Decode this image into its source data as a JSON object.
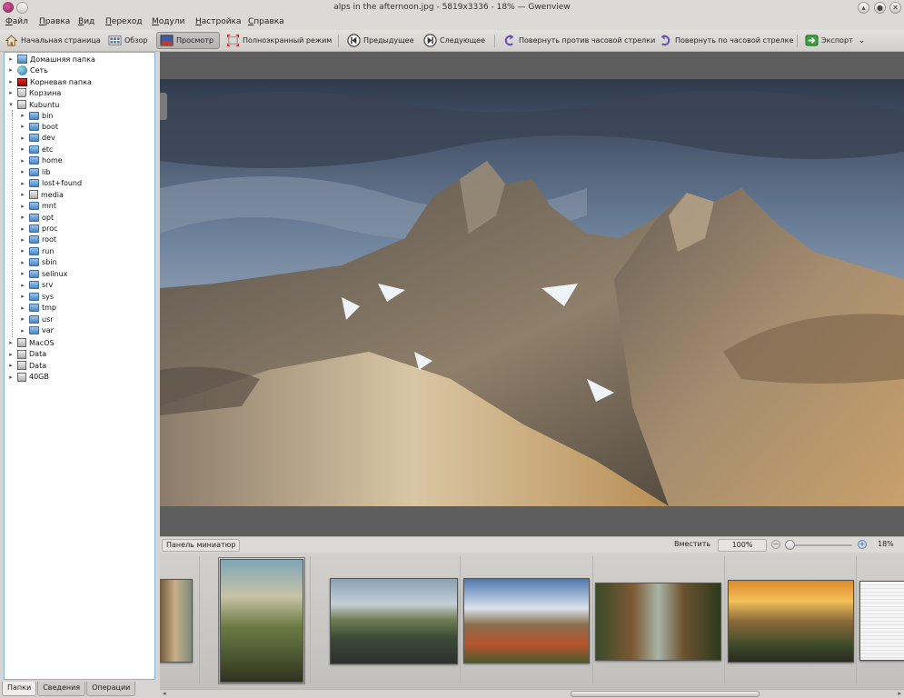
{
  "window": {
    "title": "alps in the afternoon.jpg - 5819x3336 - 18% — Gwenview",
    "buttons": [
      "▴",
      "●",
      "✕"
    ]
  },
  "menubar": [
    "Файл",
    "Правка",
    "Вид",
    "Переход",
    "Модули",
    "Настройка",
    "Справка"
  ],
  "toolbar": {
    "home": "Начальная страница",
    "browse": "Обзор",
    "view": "Просмотр",
    "fullscreen": "Полноэкранный режим",
    "prev": "Предыдущее",
    "next": "Следующее",
    "rotate_left": "Повернуть против часовой стрелки",
    "rotate_right": "Повернуть по часовой стрелке",
    "export": "Экспорт",
    "export_arrow": "⌄"
  },
  "sidebar": {
    "places": [
      {
        "label": "Домашняя папка",
        "icon": "home-folder-icon"
      },
      {
        "label": "Сеть",
        "icon": "network-icon"
      },
      {
        "label": "Корневая папка",
        "icon": "root-folder-icon"
      },
      {
        "label": "Корзина",
        "icon": "trash-icon"
      },
      {
        "label": "Kubuntu",
        "icon": "drive-icon"
      }
    ],
    "kubuntu_children": [
      "bin",
      "boot",
      "dev",
      "etc",
      "home",
      "lib",
      "lost+found",
      "media",
      "mnt",
      "opt",
      "proc",
      "root",
      "run",
      "sbin",
      "selinux",
      "srv",
      "sys",
      "tmp",
      "usr",
      "var"
    ],
    "drives": [
      "MacOS",
      "Data",
      "Data",
      "40GB"
    ],
    "tabs": [
      "Папки",
      "Сведения",
      "Операции"
    ]
  },
  "thumbbar": {
    "panel_label": "Панель миниатюр",
    "fit_label": "Вместить",
    "zoom_value": "100%",
    "zoom_out_glyph": "−",
    "zoom_in_glyph": "+",
    "zoom_percent": "18%",
    "slider_fraction": 0.0
  },
  "scroll": {
    "left": "◂",
    "right": "▸"
  }
}
